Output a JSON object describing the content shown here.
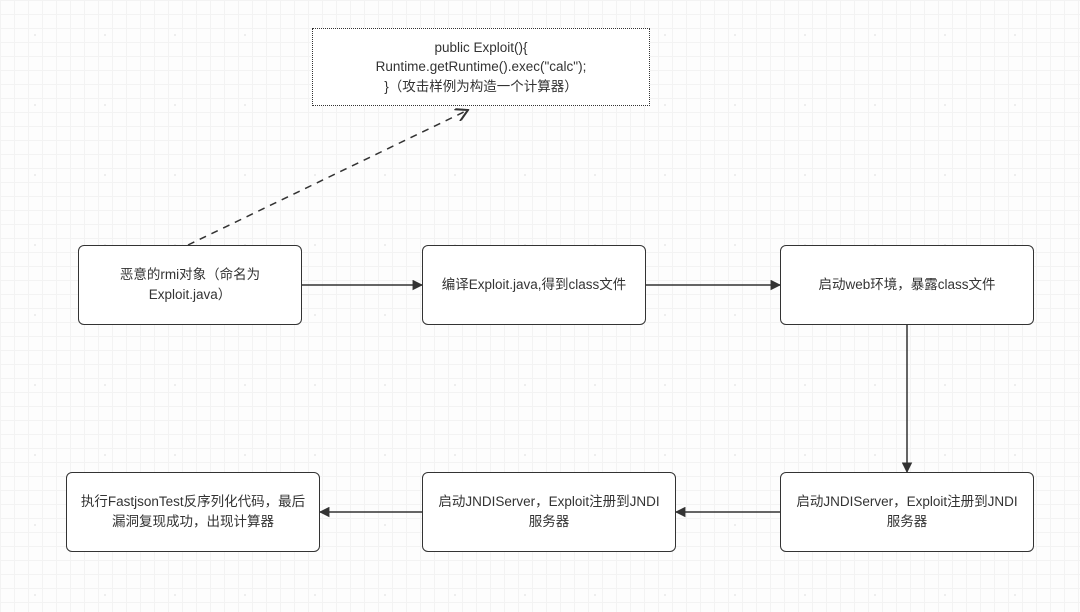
{
  "nodes": {
    "callout": {
      "line1": "public Exploit(){",
      "line2": "Runtime.getRuntime().exec(\"calc\");",
      "line3": "}（攻击样例为构造一个计算器）"
    },
    "step1": "恶意的rmi对象（命名为Exploit.java）",
    "step2": "编译Exploit.java,得到class文件",
    "step3": "启动web环境，暴露class文件",
    "step4": "启动JNDIServer，Exploit注册到JNDI服务器",
    "step5": "启动JNDIServer，Exploit注册到JNDI服务器",
    "step6": "执行FastjsonTest反序列化代码，最后漏洞复现成功，出现计算器"
  },
  "chart_data": {
    "type": "flowchart",
    "nodes": [
      {
        "id": "callout",
        "text": "public Exploit(){ Runtime.getRuntime().exec(\"calc\"); }（攻击样例为构造一个计算器）",
        "style": "dotted-note"
      },
      {
        "id": "step1",
        "text": "恶意的rmi对象（命名为Exploit.java）"
      },
      {
        "id": "step2",
        "text": "编译Exploit.java,得到class文件"
      },
      {
        "id": "step3",
        "text": "启动web环境，暴露class文件"
      },
      {
        "id": "step4",
        "text": "启动JNDIServer，Exploit注册到JNDI服务器"
      },
      {
        "id": "step5",
        "text": "启动JNDIServer，Exploit注册到JNDI服务器"
      },
      {
        "id": "step6",
        "text": "执行FastjsonTest反序列化代码，最后漏洞复现成功，出现计算器"
      }
    ],
    "edges": [
      {
        "from": "step1",
        "to": "callout",
        "style": "dashed"
      },
      {
        "from": "step1",
        "to": "step2",
        "style": "solid"
      },
      {
        "from": "step2",
        "to": "step3",
        "style": "solid"
      },
      {
        "from": "step3",
        "to": "step4",
        "style": "solid"
      },
      {
        "from": "step4",
        "to": "step5",
        "style": "solid"
      },
      {
        "from": "step5",
        "to": "step6",
        "style": "solid"
      }
    ]
  }
}
